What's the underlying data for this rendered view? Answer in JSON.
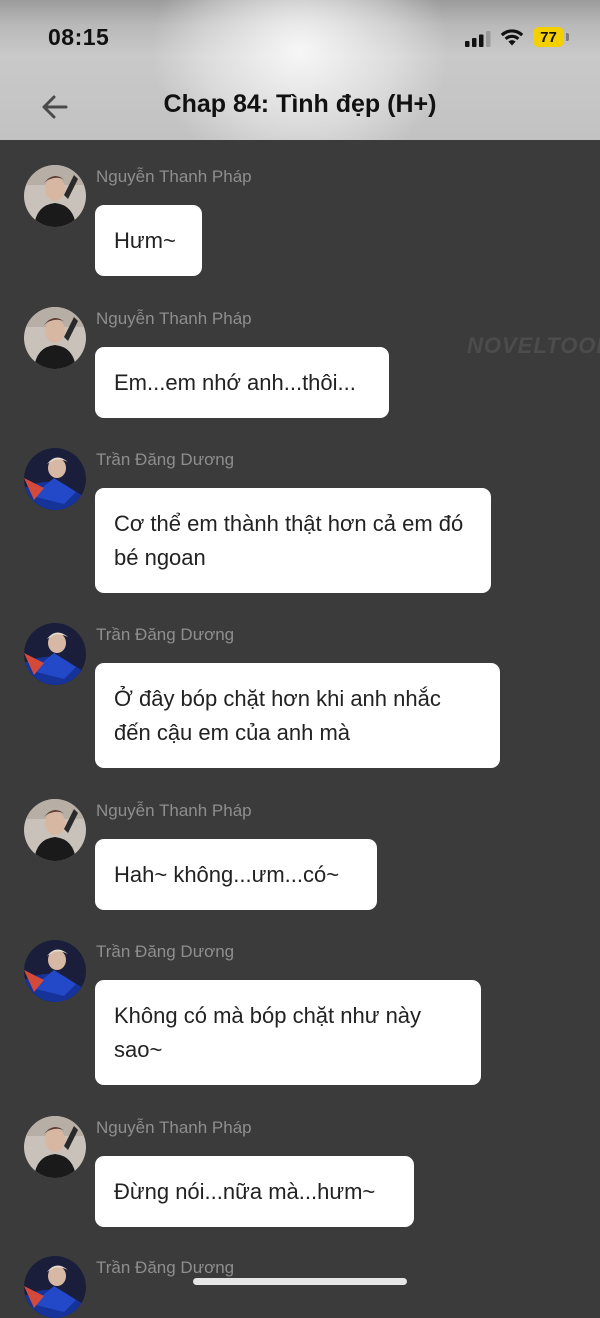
{
  "status_bar": {
    "time": "08:15",
    "battery": "77"
  },
  "header": {
    "title": "Chap 84: Tình đẹp (H+)"
  },
  "watermark": "NOVELTOON",
  "messages": [
    {
      "sender": "Nguyễn Thanh Pháp",
      "text": "Hưm~"
    },
    {
      "sender": "Nguyễn Thanh Pháp",
      "text": "Em...em nhớ anh...thôi..."
    },
    {
      "sender": "Trần Đăng Dương",
      "text": "Cơ thể em thành thật hơn cả em đó bé ngoan"
    },
    {
      "sender": "Trần Đăng Dương",
      "text": "Ở đây bóp chặt hơn khi anh nhắc đến cậu em của anh mà"
    },
    {
      "sender": "Nguyễn Thanh Pháp",
      "text": "Hah~ không...ưm...có~"
    },
    {
      "sender": "Trần Đăng Dương",
      "text": "Không có mà bóp chặt như này sao~"
    },
    {
      "sender": "Nguyễn Thanh Pháp",
      "text": "Đừng nói...nữa mà...hưm~"
    },
    {
      "sender": "Trần Đăng Dương",
      "text": ""
    }
  ]
}
